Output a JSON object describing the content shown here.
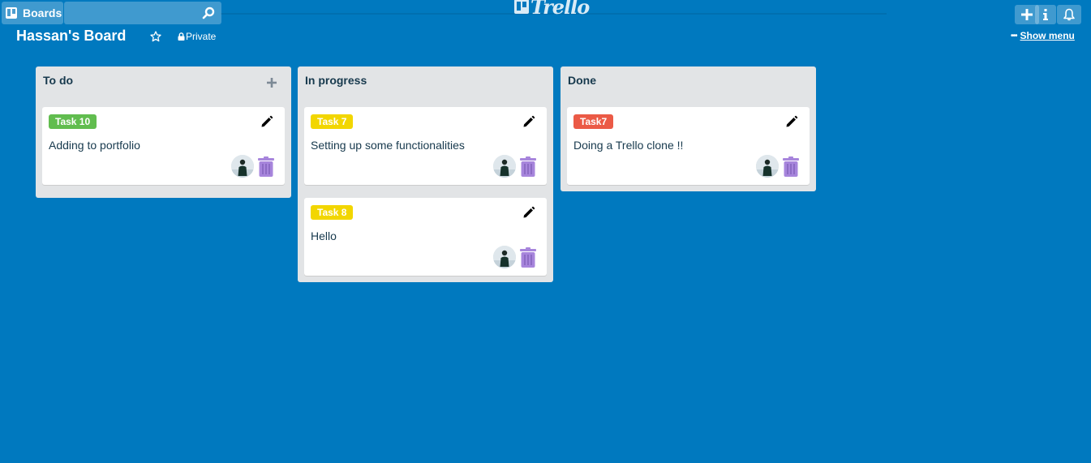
{
  "topbar": {
    "boards_label": "Boards",
    "search_value": "",
    "logo_text": "Trello"
  },
  "board": {
    "title": "Hassan's Board",
    "visibility": "Private",
    "show_menu_dots": "•••",
    "show_menu_label": "Show menu"
  },
  "lists": [
    {
      "title": "To do",
      "cards": [
        {
          "label": "Task 10",
          "label_color": "#61bd4f",
          "text": "Adding to portfolio"
        }
      ]
    },
    {
      "title": "In progress",
      "cards": [
        {
          "label": "Task 7",
          "label_color": "#f2d600",
          "text": "Setting up some functionalities"
        },
        {
          "label": "Task 8",
          "label_color": "#f2d600",
          "text": "Hello"
        }
      ]
    },
    {
      "title": "Done",
      "cards": [
        {
          "label": "Task7",
          "label_color": "#eb5a46",
          "text": "Doing a Trello clone !!"
        }
      ]
    }
  ],
  "colors": {
    "background": "#0079bf",
    "list_bg": "#e2e4e6",
    "trash": "#a785dc"
  },
  "icons": [
    "boards-icon",
    "search-icon",
    "trello-logo-icon",
    "plus-icon",
    "info-icon",
    "bell-icon",
    "star-icon",
    "lock-icon",
    "add-card-icon",
    "pencil-icon",
    "avatar",
    "trash-icon"
  ]
}
